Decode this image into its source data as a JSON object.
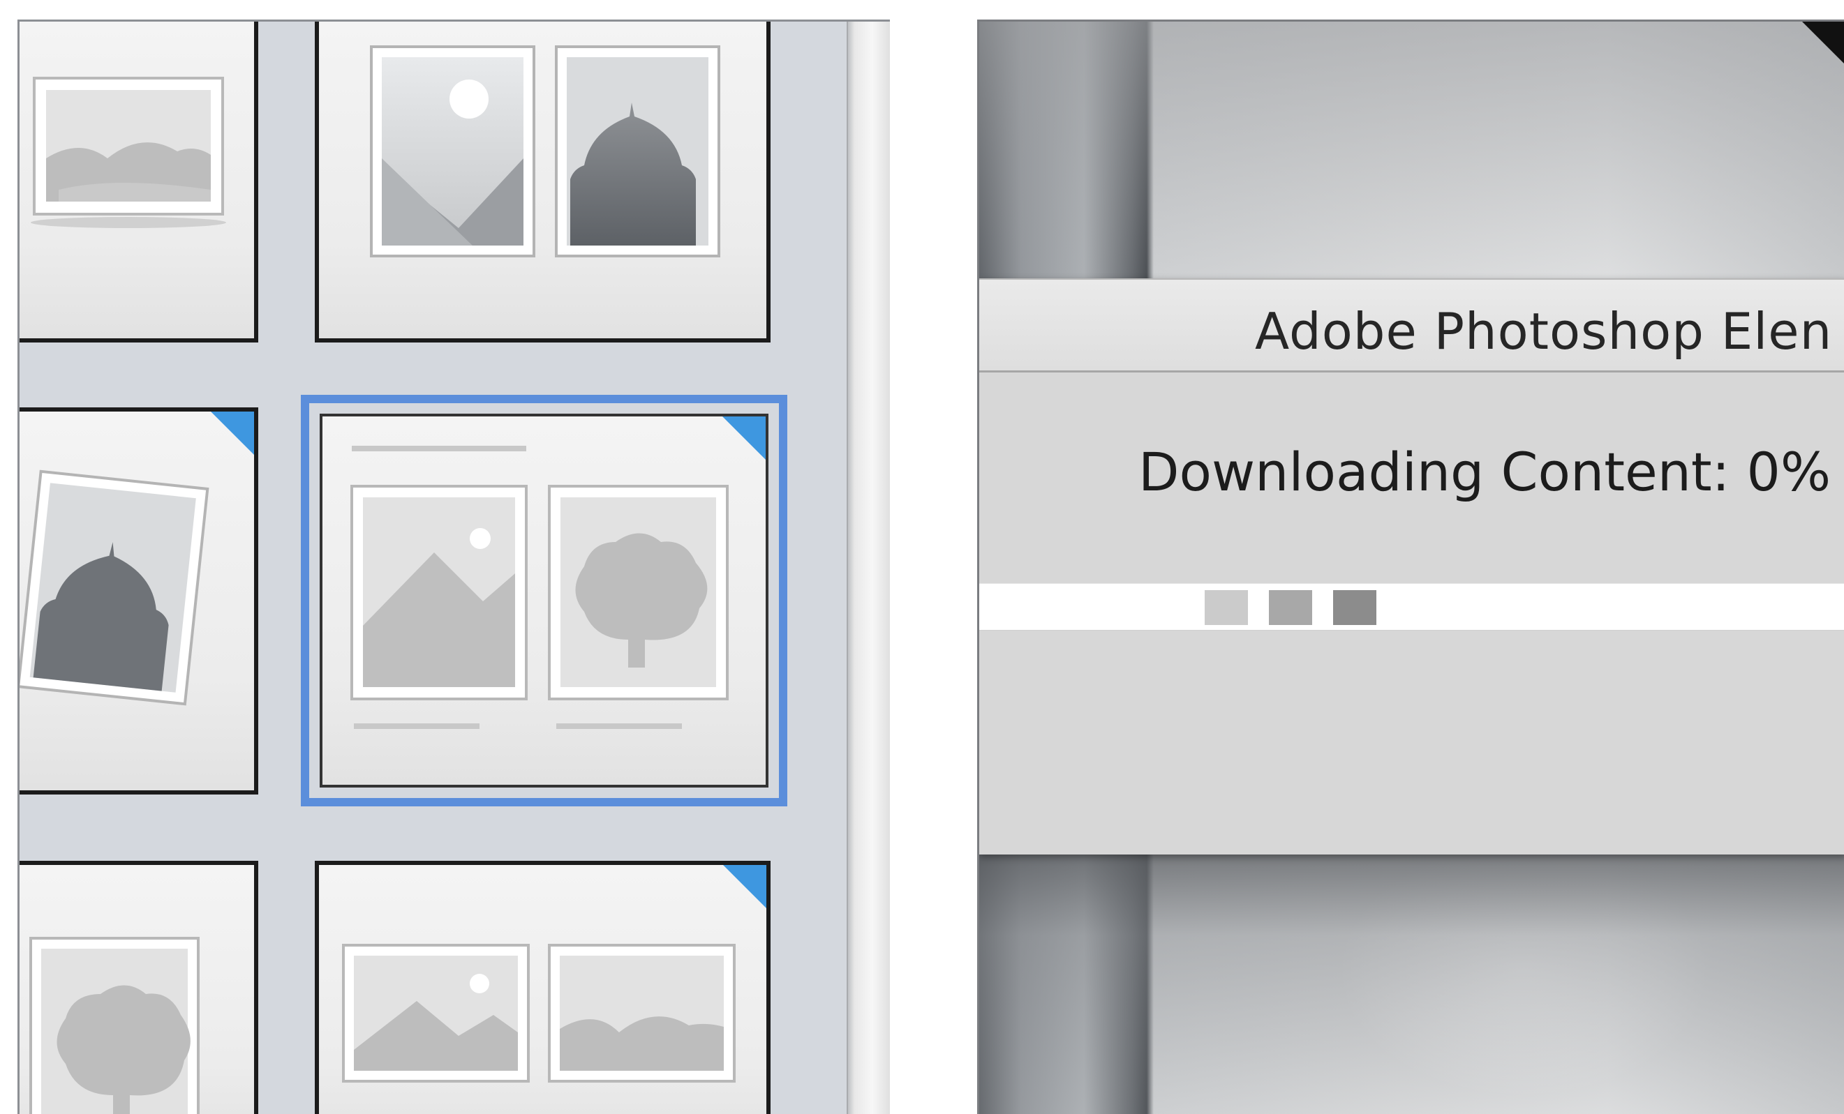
{
  "dialog": {
    "title": "Adobe Photoshop Elen",
    "status": "Downloading Content: 0%",
    "progress_percent": 0,
    "activity_squares": [
      "#cbcbcb",
      "#a8a8a8",
      "#8c8c8c"
    ]
  },
  "layout_panel": {
    "selection_color": "#5b8edb",
    "badge_color": "#3e97e0",
    "tiles": [
      {
        "name": "layout-tile-single-landscape",
        "badge": false,
        "selected": false
      },
      {
        "name": "layout-tile-two-photos",
        "badge": false,
        "selected": false
      },
      {
        "name": "layout-tile-tilted-photo",
        "badge": true,
        "selected": false
      },
      {
        "name": "layout-tile-two-photos-captions",
        "badge": true,
        "selected": true
      },
      {
        "name": "layout-tile-tree-photo",
        "badge": false,
        "selected": false
      },
      {
        "name": "layout-tile-two-landscapes",
        "badge": true,
        "selected": false
      }
    ]
  }
}
